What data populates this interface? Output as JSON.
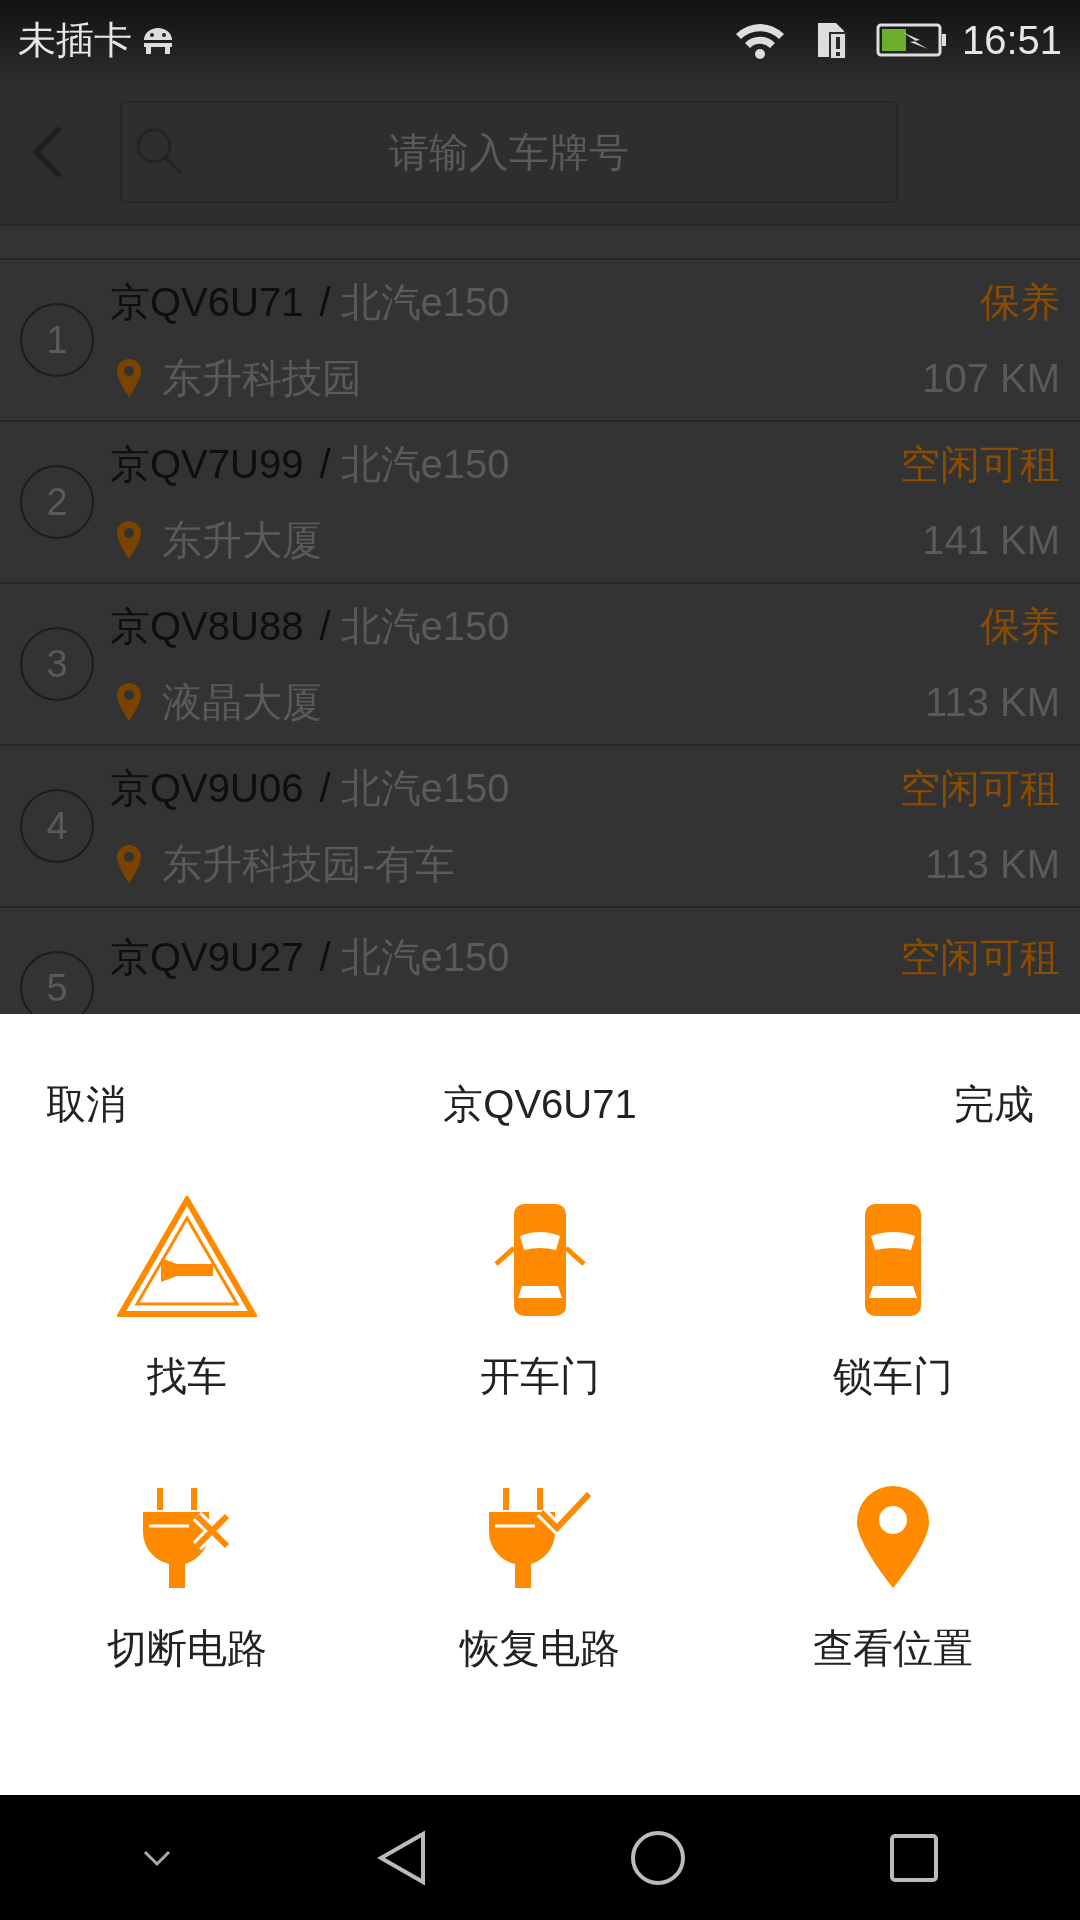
{
  "status_bar": {
    "carrier": "未插卡",
    "time": "16:51"
  },
  "search": {
    "placeholder": "请输入车牌号"
  },
  "separator": "/",
  "vehicles": [
    {
      "index": "1",
      "plate": "京QV6U71",
      "model": "北汽e150",
      "status": "保养",
      "location": "东升科技园",
      "range": "107 KM"
    },
    {
      "index": "2",
      "plate": "京QV7U99",
      "model": "北汽e150",
      "status": "空闲可租",
      "location": "东升大厦",
      "range": "141 KM"
    },
    {
      "index": "3",
      "plate": "京QV8U88",
      "model": "北汽e150",
      "status": "保养",
      "location": "液晶大厦",
      "range": "113 KM"
    },
    {
      "index": "4",
      "plate": "京QV9U06",
      "model": "北汽e150",
      "status": "空闲可租",
      "location": "东升科技园-有车",
      "range": "113 KM"
    },
    {
      "index": "5",
      "plate": "京QV9U27",
      "model": "北汽e150",
      "status": "空闲可租"
    }
  ],
  "sheet": {
    "cancel": "取消",
    "title": "京QV6U71",
    "done": "完成",
    "actions": [
      {
        "kind": "horn",
        "label": "找车"
      },
      {
        "kind": "unlock",
        "label": "开车门"
      },
      {
        "kind": "lock",
        "label": "锁车门"
      },
      {
        "kind": "cut",
        "label": "切断电路"
      },
      {
        "kind": "restore",
        "label": "恢复电路"
      },
      {
        "kind": "locate",
        "label": "查看位置"
      }
    ]
  }
}
